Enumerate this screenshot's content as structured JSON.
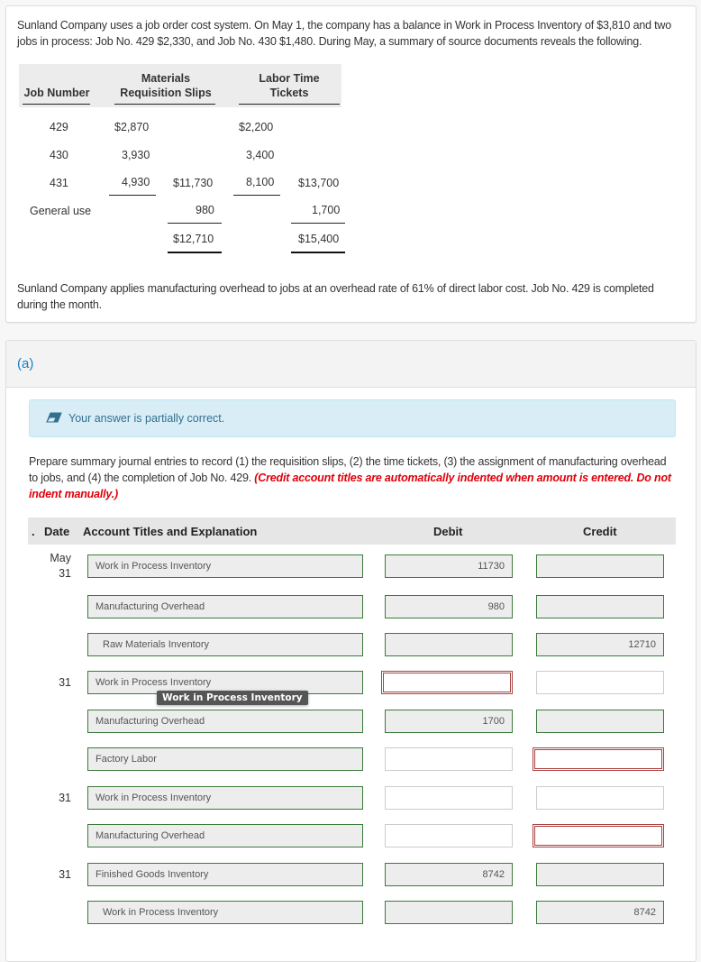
{
  "problem": {
    "intro": "Sunland Company uses a job order cost system. On May 1, the company has a balance in Work in Process Inventory of $3,810 and two jobs in process: Job No. 429 $2,330, and Job No. 430 $1,480. During May, a summary of source documents reveals the following.",
    "overhead_note": "Sunland Company applies manufacturing overhead to jobs at an overhead rate of 61% of direct labor cost. Job No. 429 is completed during the month."
  },
  "source_table": {
    "headers": {
      "job_number": "Job Number",
      "materials_line1": "Materials",
      "materials_line2": "Requisition Slips",
      "labor_line1": "Labor Time",
      "labor_line2": "Tickets"
    },
    "rows": [
      {
        "job": "429",
        "materials": "$2,870",
        "materials_total": "",
        "labor": "$2,200",
        "labor_total": ""
      },
      {
        "job": "430",
        "materials": "3,930",
        "materials_total": "",
        "labor": "3,400",
        "labor_total": ""
      },
      {
        "job": "431",
        "materials": "4,930",
        "materials_total": "$11,730",
        "labor": "8,100",
        "labor_total": "$13,700"
      },
      {
        "job": "General use",
        "materials": "",
        "materials_total": "980",
        "labor": "",
        "labor_total": "1,700"
      },
      {
        "job": "",
        "materials": "",
        "materials_total": "$12,710",
        "labor": "",
        "labor_total": "$15,400"
      }
    ]
  },
  "part": {
    "label": "(a)",
    "feedback": {
      "icon": "eraser-icon",
      "text": "Your answer is partially correct."
    },
    "instructions": "Prepare summary journal entries to record (1) the requisition slips, (2) the time tickets, (3) the assignment of manufacturing overhead to jobs, and (4) the completion of Job No. 429.",
    "instructions_note": "(Credit account titles are automatically indented when amount is entered. Do not indent manually.)"
  },
  "journal": {
    "headers": {
      "no": ".",
      "date": "Date",
      "account": "Account Titles and Explanation",
      "debit": "Debit",
      "credit": "Credit"
    },
    "rows": [
      {
        "date": "May\n31",
        "account": "Work in Process Inventory",
        "debit": "11730",
        "credit": "",
        "debit_state": "ok",
        "credit_state": "ok",
        "indent": false
      },
      {
        "date": "",
        "account": "Manufacturing Overhead",
        "debit": "980",
        "credit": "",
        "debit_state": "ok",
        "credit_state": "ok",
        "indent": false
      },
      {
        "date": "",
        "account": "Raw Materials Inventory",
        "debit": "",
        "credit": "12710",
        "debit_state": "ok",
        "credit_state": "ok",
        "indent": true
      },
      {
        "date": "31",
        "account": "Work in Process Inventory",
        "debit": "",
        "credit": "",
        "debit_state": "err",
        "credit_state": "empty",
        "indent": false
      },
      {
        "date": "",
        "account": "Manufacturing Overhead",
        "debit": "1700",
        "credit": "",
        "debit_state": "ok",
        "credit_state": "ok",
        "indent": false
      },
      {
        "date": "",
        "account": "Factory Labor",
        "debit": "",
        "credit": "",
        "debit_state": "empty",
        "credit_state": "err",
        "indent": false
      },
      {
        "date": "31",
        "account": "Work in Process Inventory",
        "debit": "",
        "credit": "",
        "debit_state": "empty",
        "credit_state": "empty",
        "indent": false
      },
      {
        "date": "",
        "account": "Manufacturing Overhead",
        "debit": "",
        "credit": "",
        "debit_state": "empty",
        "credit_state": "err",
        "indent": false
      },
      {
        "date": "31",
        "account": "Finished Goods Inventory",
        "debit": "8742",
        "credit": "",
        "debit_state": "ok",
        "credit_state": "ok",
        "indent": false
      },
      {
        "date": "",
        "account": "Work in Process Inventory",
        "debit": "",
        "credit": "8742",
        "debit_state": "ok",
        "credit_state": "ok",
        "indent": true
      }
    ],
    "tooltip": "Work in Process Inventory"
  },
  "colors": {
    "correct_border": "#3c7a3c",
    "error_border": "#a94442",
    "feedback_bg": "#d9edf7",
    "feedback_text": "#31708f",
    "note_red": "#e0000a",
    "part_label": "#1a7fbf"
  }
}
